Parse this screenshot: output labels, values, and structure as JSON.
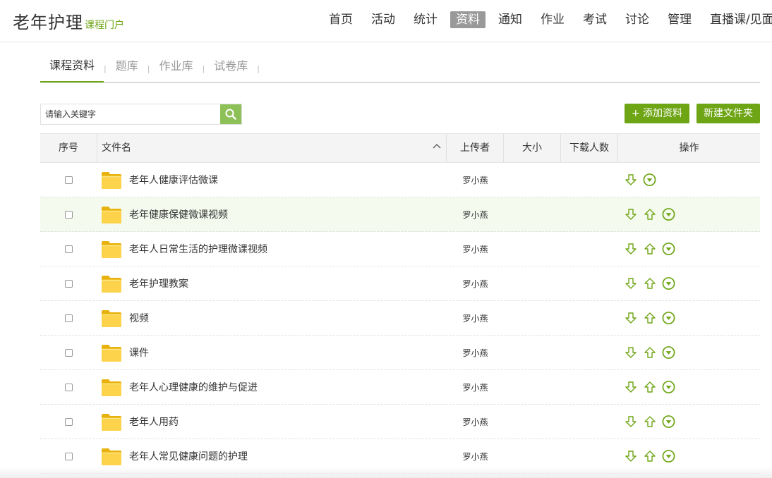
{
  "header": {
    "brand_title": "老年护理",
    "brand_sub": "课程门户",
    "nav": [
      "首页",
      "活动",
      "统计",
      "资料",
      "通知",
      "作业",
      "考试",
      "讨论",
      "管理",
      "直播课/见面课"
    ],
    "active_nav": "资料"
  },
  "subtabs": [
    "课程资料",
    "题库",
    "作业库",
    "试卷库"
  ],
  "search": {
    "placeholder": "请输入关键字"
  },
  "actions": {
    "add": "+ 添加资料",
    "new_folder": "新建文件夹"
  },
  "table": {
    "headers": {
      "index": "序号",
      "name": "文件名",
      "uploader": "上传者",
      "size": "大小",
      "downloads": "下载人数",
      "ops": "操作"
    },
    "rows": [
      {
        "name": "老年人健康评估微课",
        "uploader": "罗小燕",
        "ops": [
          "download",
          "more"
        ]
      },
      {
        "name": "老年健康保健微课视频",
        "uploader": "罗小燕",
        "ops": [
          "download",
          "upload",
          "more"
        ]
      },
      {
        "name": "老年人日常生活的护理微课视频",
        "uploader": "罗小燕",
        "ops": [
          "download",
          "upload",
          "more"
        ]
      },
      {
        "name": "老年护理教案",
        "uploader": "罗小燕",
        "ops": [
          "download",
          "upload",
          "more"
        ]
      },
      {
        "name": "视频",
        "uploader": "罗小燕",
        "ops": [
          "download",
          "upload",
          "more"
        ]
      },
      {
        "name": "课件",
        "uploader": "罗小燕",
        "ops": [
          "download",
          "upload",
          "more"
        ]
      },
      {
        "name": "老年人心理健康的维护与促进",
        "uploader": "罗小燕",
        "ops": [
          "download",
          "upload",
          "more"
        ]
      },
      {
        "name": "老年人用药",
        "uploader": "罗小燕",
        "ops": [
          "download",
          "upload",
          "more"
        ]
      },
      {
        "name": "老年人常见健康问题的护理",
        "uploader": "罗小燕",
        "ops": [
          "download",
          "upload",
          "more"
        ]
      }
    ]
  },
  "colors": {
    "accent": "#6ea515",
    "search_btn": "#8ec058",
    "active_nav_bg": "#999999",
    "folder": "#f5c518"
  },
  "icons": {
    "search": "search-icon",
    "folder": "folder-icon",
    "download": "arrow-down-icon",
    "upload": "arrow-up-icon",
    "more": "circle-chevron-down-icon",
    "sort": "chevron-up-icon"
  }
}
